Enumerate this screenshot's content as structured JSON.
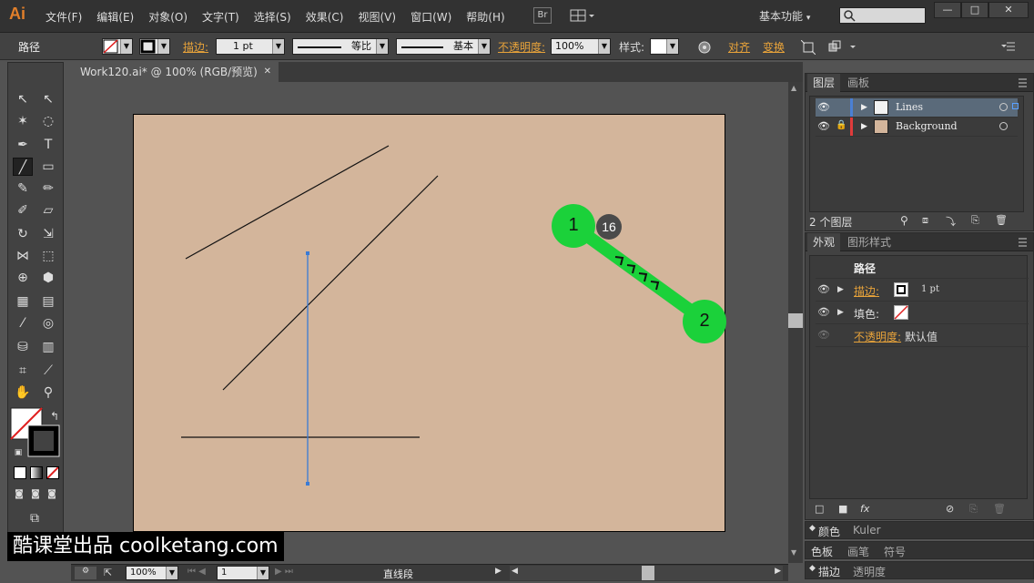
{
  "app": {
    "logo": "Ai",
    "menus": [
      "文件(F)",
      "编辑(E)",
      "对象(O)",
      "文字(T)",
      "选择(S)",
      "效果(C)",
      "视图(V)",
      "窗口(W)",
      "帮助(H)"
    ],
    "bridge": "Br",
    "workspace": "基本功能",
    "workspace_arrow": "▾"
  },
  "window": {
    "minimize": "—",
    "maximize": "□",
    "close": "✕"
  },
  "control": {
    "object_type": "路径",
    "stroke_label": "描边:",
    "stroke_weight": "1 pt",
    "profile": "等比",
    "brush": "基本",
    "opacity_label": "不透明度:",
    "opacity": "100%",
    "style_label": "样式:",
    "align": "对齐",
    "transform": "变换"
  },
  "document": {
    "tab_title": "Work120.ai* @ 100% (RGB/预览)",
    "tab_close": "✕"
  },
  "status": {
    "zoom": "100%",
    "page": "1",
    "tool": "直线段"
  },
  "layers": {
    "tabs": [
      "图层",
      "画板"
    ],
    "rows": [
      {
        "name": "Lines",
        "color": "#4a7fd4"
      },
      {
        "name": "Background",
        "color": "#e03b3b"
      }
    ],
    "count": "2 个图层"
  },
  "appearance": {
    "tabs": [
      "外观",
      "图形样式"
    ],
    "title": "路径",
    "stroke_label": "描边:",
    "stroke_value": "1 pt",
    "fill_label": "填色:",
    "opacity_label": "不透明度:",
    "opacity_value": "默认值"
  },
  "collapsed_panels": [
    [
      "颜色",
      "Kuler"
    ],
    [
      "色板",
      "画笔",
      "符号"
    ],
    [
      "描边",
      "透明度"
    ]
  ],
  "callouts": {
    "a": "1",
    "b": "2",
    "step": "16"
  },
  "watermark": "酷课堂出品 coolketang.com",
  "colors": {
    "artboard": "#d3b59b",
    "accent": "#1bd13a",
    "selection": "#3a7bd5"
  }
}
